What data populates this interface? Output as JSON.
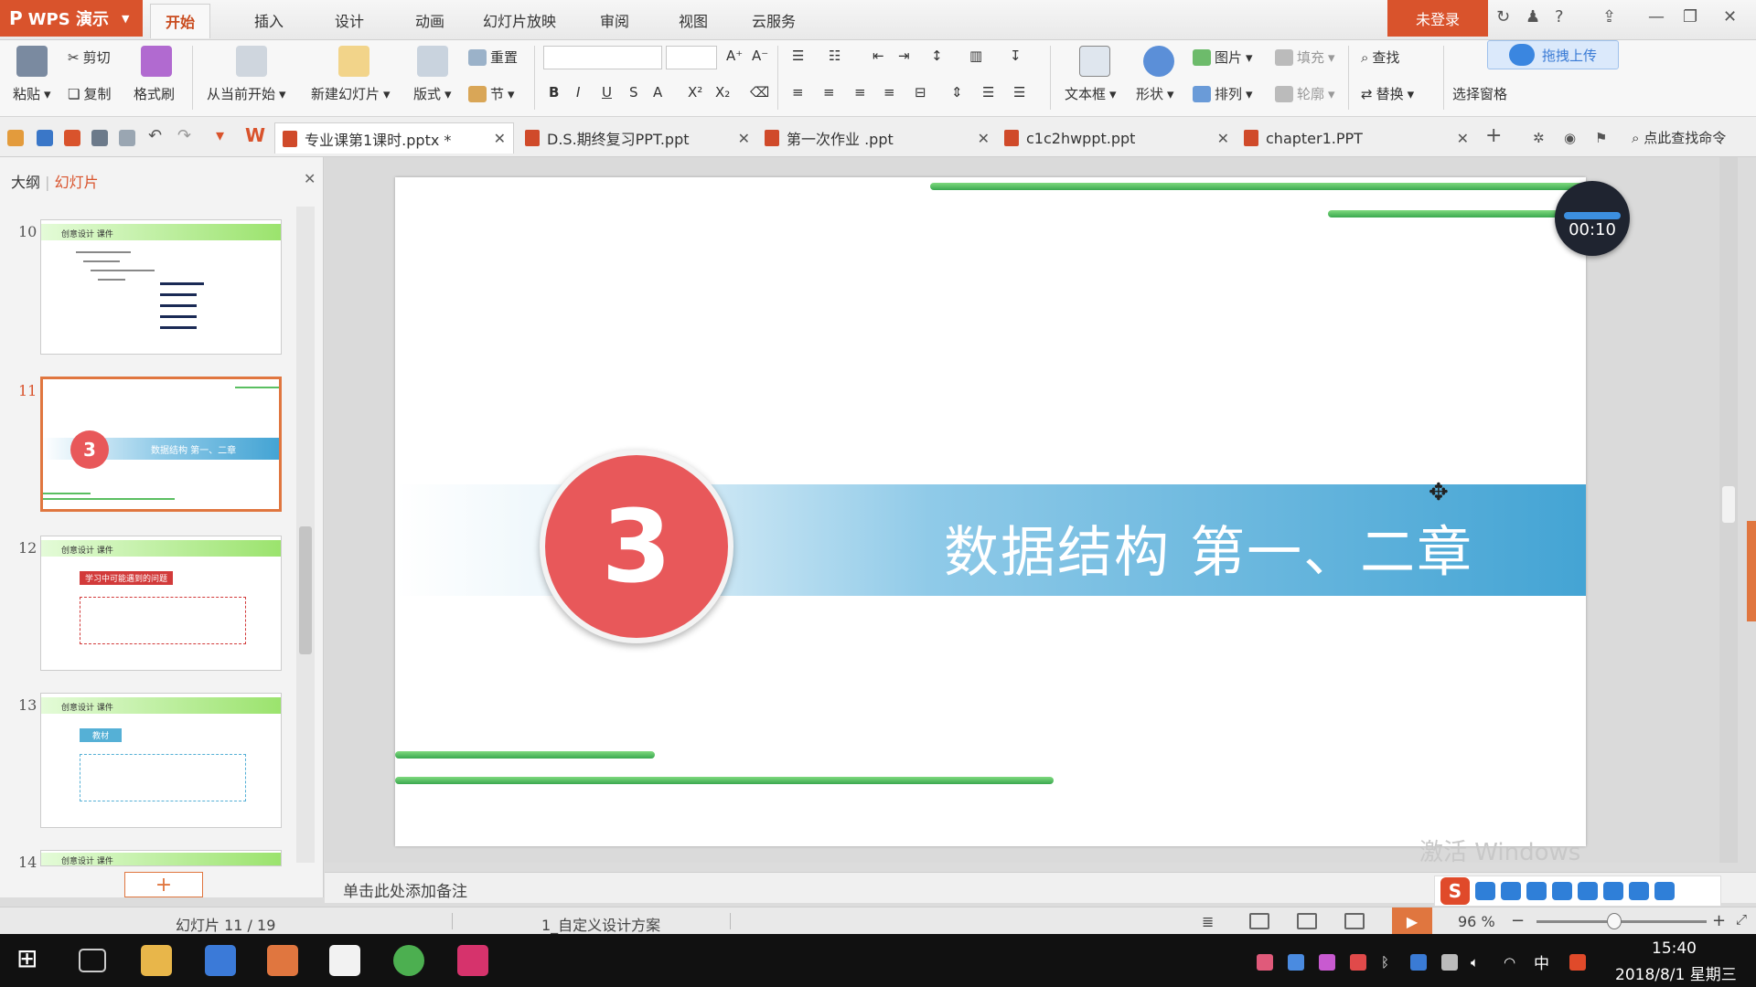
{
  "app": {
    "name": "WPS 演示",
    "logo": "P"
  },
  "menu": [
    "开始",
    "插入",
    "设计",
    "动画",
    "幻灯片放映",
    "审阅",
    "视图",
    "云服务"
  ],
  "account": {
    "login_label": "未登录",
    "upload_label": "拖拽上传"
  },
  "ribbon": {
    "paste": "粘贴",
    "cut": "剪切",
    "copy": "复制",
    "format_painter": "格式刷",
    "from_current": "从当前开始",
    "new_slide": "新建幻灯片",
    "layout": "版式",
    "reset": "重置",
    "section": "节",
    "textbox": "文本框",
    "shape": "形状",
    "picture": "图片",
    "arrange": "排列",
    "fill": "填充",
    "outline": "轮廓",
    "find": "查找",
    "replace": "替换",
    "selection_pane": "选择窗格"
  },
  "documents": [
    {
      "name": "专业课第1课时.pptx *",
      "active": true
    },
    {
      "name": "D.S.期终复习PPT.ppt",
      "active": false
    },
    {
      "name": "第一次作业 .ppt",
      "active": false
    },
    {
      "name": "c1c2hwppt.ppt",
      "active": false
    },
    {
      "name": "chapter1.PPT",
      "active": false
    }
  ],
  "command_search": "点此查找命令",
  "panel": {
    "tab_outline": "大纲",
    "tab_slides": "幻灯片"
  },
  "thumbnails": [
    {
      "number": "10",
      "header": "创意设计 课件"
    },
    {
      "number": "11",
      "circle": "3",
      "title": "数据结构 第一、二章"
    },
    {
      "number": "12",
      "header": "创意设计 课件",
      "tag": "学习中可能遇到的问题"
    },
    {
      "number": "13",
      "header": "创意设计 课件",
      "tag": "教材"
    },
    {
      "number": "14",
      "header": "创意设计 课件"
    }
  ],
  "slide": {
    "number": "3",
    "title": "数据结构 第一、二章"
  },
  "timer": "00:10",
  "notes_placeholder": "单击此处添加备注",
  "watermark": "激活 Windows",
  "status": {
    "slide_count": "幻灯片 11 / 19",
    "design_scheme": "1_自定义设计方案",
    "zoom": "96 %"
  },
  "taskbar": {
    "time": "15:40",
    "date": "2018/8/1 星期三",
    "lang": "中"
  },
  "colors": {
    "accent": "#d9532c",
    "slide_circle": "#e8585a",
    "banner": "#44a4d4",
    "green_line": "#3aa84f"
  }
}
